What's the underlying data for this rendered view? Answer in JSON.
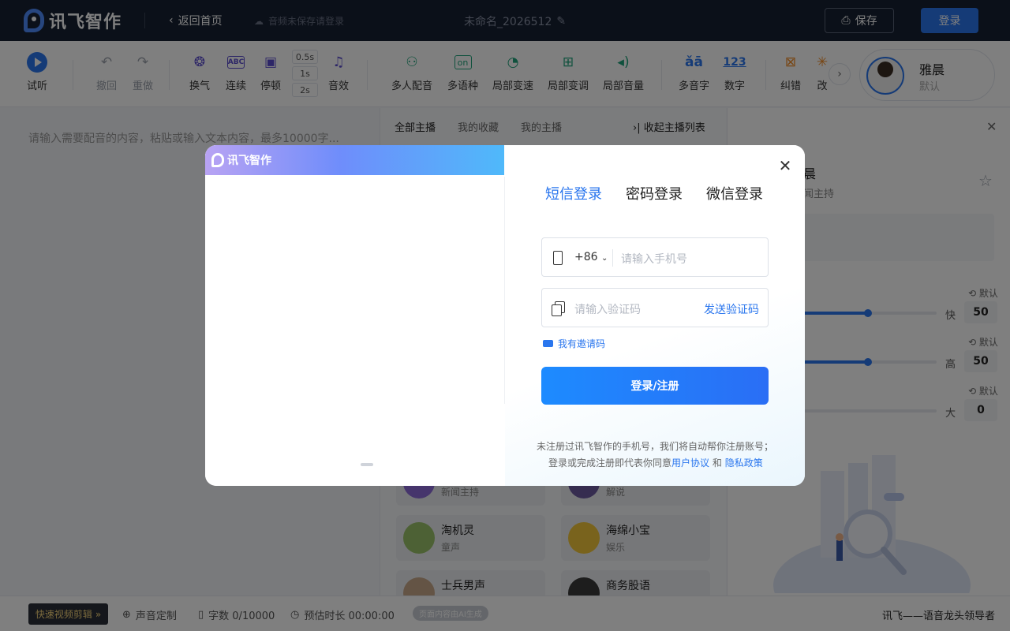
{
  "topbar": {
    "logo_text": "讯飞智作",
    "back_label": "返回首页",
    "cloud_note": "音频未保存请登录",
    "doc_title": "未命名_2026512",
    "save_label": "保存",
    "login_label": "登录"
  },
  "toolbar": {
    "items": [
      {
        "label": "试听",
        "icon": "play-icon"
      },
      {
        "label": "撤回",
        "icon": "undo-icon"
      },
      {
        "label": "重做",
        "icon": "redo-icon"
      },
      {
        "label": "换气",
        "icon": "breath-icon"
      },
      {
        "label": "连续",
        "icon": "abc-icon"
      },
      {
        "label": "停顿",
        "icon": "pause-icon"
      },
      {
        "label": "音效",
        "icon": "music-note-icon"
      },
      {
        "label": "多人配音",
        "icon": "people-icon"
      },
      {
        "label": "多语种",
        "icon": "language-icon"
      },
      {
        "label": "局部变速",
        "icon": "speedometer-icon"
      },
      {
        "label": "局部变调",
        "icon": "tone-icon"
      },
      {
        "label": "局部音量",
        "icon": "volume-icon"
      },
      {
        "label": "多音字",
        "icon": "polyphone-icon"
      },
      {
        "label": "数字",
        "icon": "number-icon"
      },
      {
        "label": "纠错",
        "icon": "correction-icon"
      },
      {
        "label": "改",
        "icon": "rewrite-icon"
      }
    ],
    "pause_options": [
      "0.5s",
      "1s",
      "2s"
    ],
    "abc_text": "ABC",
    "polyphone_text": "ǎā",
    "number_text": "123",
    "voice": {
      "name": "雅晨",
      "sub": "默认"
    }
  },
  "editor": {
    "placeholder": "请输入需要配音的内容，粘贴或输入文本内容，最多10000字..."
  },
  "anchors": {
    "tabs": [
      "全部主播",
      "我的收藏",
      "我的主播"
    ],
    "collapse_label": "收起主播列表",
    "cards": [
      {
        "name": "",
        "tag": "新闻主持"
      },
      {
        "name": "",
        "tag": "解说"
      },
      {
        "name": "淘机灵",
        "tag": "童声"
      },
      {
        "name": "海绵小宝",
        "tag": "娱乐"
      },
      {
        "name": "士兵男声",
        "tag": ""
      },
      {
        "name": "商务股语",
        "tag": ""
      }
    ]
  },
  "detail": {
    "name_partial": "晨",
    "tag_partial": "闻主持",
    "sliders": [
      {
        "default_label": "默认",
        "end_label": "快",
        "value": "50",
        "level": 0.5
      },
      {
        "default_label": "默认",
        "end_label": "高",
        "value": "50",
        "level": 0.5
      },
      {
        "default_label": "默认",
        "end_label": "大",
        "value": "0",
        "level": 0
      }
    ]
  },
  "statusbar": {
    "fast_edit": "快速视频剪辑",
    "custom_voice": "声音定制",
    "char_count": "字数 0/10000",
    "est_duration": "预估时长 00:00:00",
    "ai_tag": "页面内容由AI生成",
    "slogan": "讯飞——语音龙头领导者"
  },
  "modal": {
    "banner_logo": "讯飞智作",
    "tabs": [
      "短信登录",
      "密码登录",
      "微信登录"
    ],
    "country_code": "+86",
    "phone_placeholder": "请输入手机号",
    "code_placeholder": "请输入验证码",
    "send_code": "发送验证码",
    "invite_code": "我有邀请码",
    "submit": "登录/注册",
    "terms_line1": "未注册过讯飞智作的手机号，我们将自动帮你注册账号；",
    "terms_line2_prefix": "登录或完成注册即代表你同意",
    "user_agreement": "用户协议",
    "and": "和",
    "privacy_policy": "隐私政策"
  },
  "colors": {
    "brand": "#2a76ee",
    "topbar": "#172033"
  }
}
